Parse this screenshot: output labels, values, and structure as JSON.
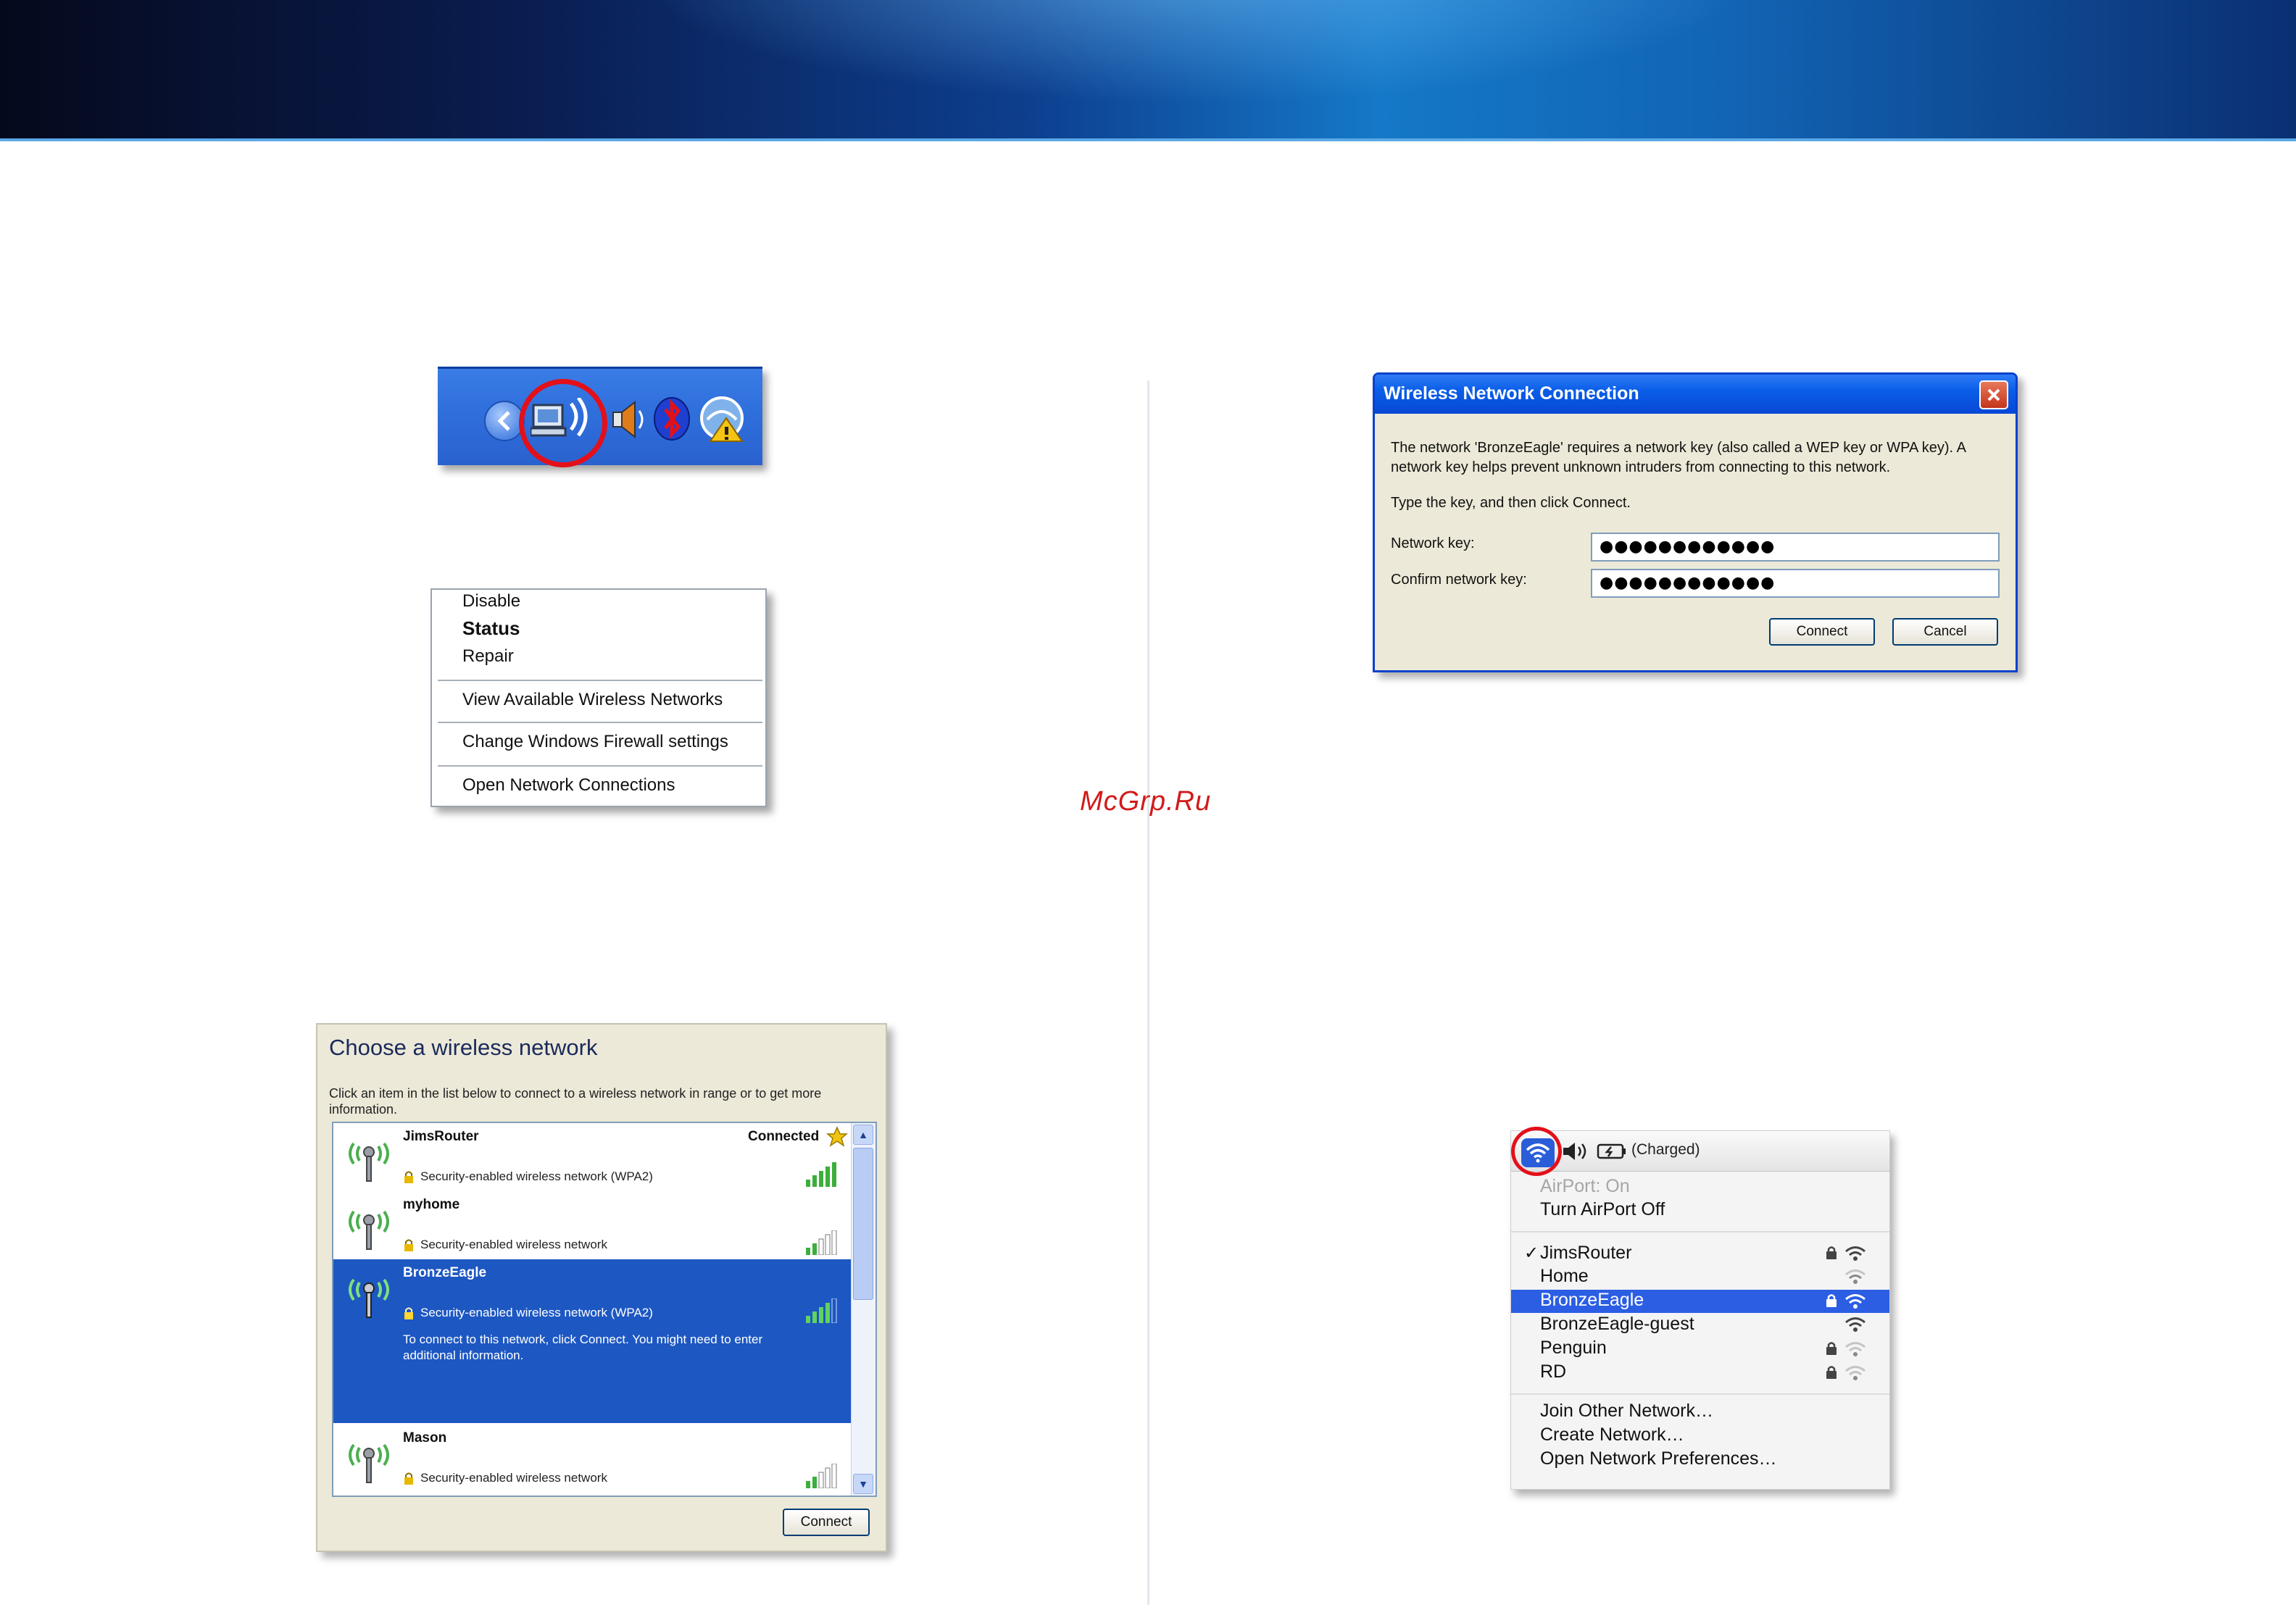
{
  "watermark": "McGrp.Ru",
  "context_menu": {
    "items": [
      {
        "label": "Disable"
      },
      {
        "label": "Status"
      },
      {
        "label": "Repair"
      },
      {
        "label": "View Available Wireless Networks"
      },
      {
        "label": "Change Windows Firewall settings"
      },
      {
        "label": "Open Network Connections"
      }
    ]
  },
  "tray": {
    "icons": [
      "show-hidden-icons-chevron-icon",
      "wireless-network-icon",
      "speaker-icon",
      "bluetooth-icon",
      "security-warning-icon"
    ]
  },
  "choose_network": {
    "title": "Choose a wireless network",
    "description": "Click an item in the list below to connect to a wireless network in range or to get more information.",
    "networks": [
      {
        "name": "JimsRouter",
        "security": "Security-enabled wireless network (WPA2)",
        "status": "Connected",
        "selected": false
      },
      {
        "name": "myhome",
        "security": "Security-enabled wireless network",
        "status": "",
        "selected": false
      },
      {
        "name": "BronzeEagle",
        "security": "Security-enabled wireless network (WPA2)",
        "status": "",
        "selected": true,
        "help": "To connect to this network, click Connect. You might need to enter additional information."
      },
      {
        "name": "Mason",
        "security": "Security-enabled wireless network",
        "status": "",
        "selected": false
      }
    ],
    "connect_label": "Connect"
  },
  "key_dialog": {
    "title": "Wireless Network Connection",
    "message": "The network 'BronzeEagle' requires a network key (also called a WEP key or WPA key). A network key helps prevent unknown intruders from connecting to this network.",
    "instruction": "Type the key, and then click Connect.",
    "network_key_label": "Network key:",
    "network_key_value": "●●●●●●●●●●●●",
    "confirm_key_label": "Confirm network key:",
    "confirm_key_value": "●●●●●●●●●●●●",
    "connect_label": "Connect",
    "cancel_label": "Cancel"
  },
  "mac_menu": {
    "battery_status": "(Charged)",
    "airport_status": "AirPort: On",
    "airport_toggle": "Turn AirPort Off",
    "networks": [
      {
        "name": "JimsRouter",
        "checked": true,
        "locked": true,
        "selected": false
      },
      {
        "name": "Home",
        "checked": false,
        "locked": false,
        "selected": false
      },
      {
        "name": "BronzeEagle",
        "checked": false,
        "locked": true,
        "selected": true
      },
      {
        "name": "BronzeEagle-guest",
        "checked": false,
        "locked": false,
        "selected": false
      },
      {
        "name": "Penguin",
        "checked": false,
        "locked": true,
        "selected": false
      },
      {
        "name": "RD",
        "checked": false,
        "locked": true,
        "selected": false
      }
    ],
    "join_other": "Join Other Network…",
    "create_network": "Create Network…",
    "open_prefs": "Open Network Preferences…"
  },
  "colors": {
    "xp_blue": "#0a5ee8",
    "selection_blue": "#1d57c2",
    "mac_selection": "#2c5ee4",
    "highlight_red": "#e3101a"
  }
}
